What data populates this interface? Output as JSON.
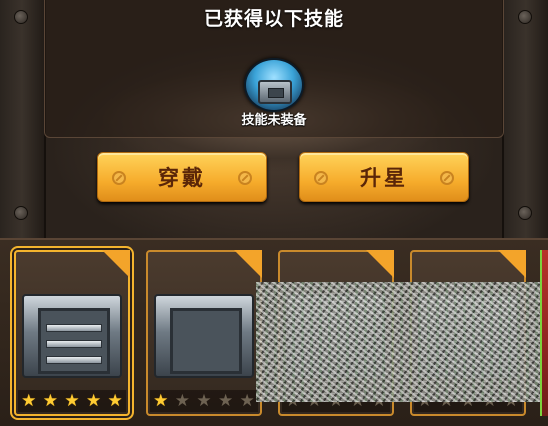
{
  "panel": {
    "title": "已获得以下技能"
  },
  "skill": {
    "icon": "armor-plate-icon",
    "status_label": "技能未装备"
  },
  "buttons": {
    "wear_label": "穿戴",
    "upgrade_label": "升星"
  },
  "cards": [
    {
      "name": "card-1",
      "stars_filled": 5,
      "stars_total": 5,
      "selected": true
    },
    {
      "name": "card-2",
      "stars_filled": 1,
      "stars_total": 5,
      "selected": false
    },
    {
      "name": "card-3",
      "stars_filled": 0,
      "stars_total": 5,
      "selected": false
    },
    {
      "name": "card-4",
      "stars_filled": 0,
      "stars_total": 5,
      "selected": false
    }
  ],
  "colors": {
    "accent": "#f6ac2c",
    "star_on": "#ffcc33",
    "button_text": "#5a2608"
  }
}
